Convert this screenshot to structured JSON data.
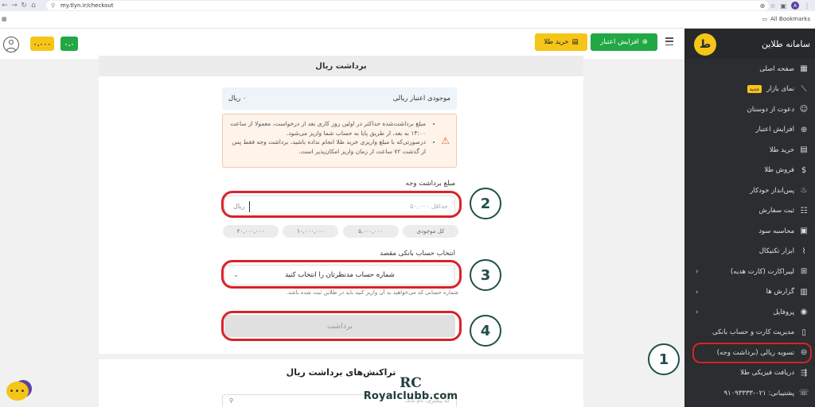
{
  "browser": {
    "url": "my.tlyn.ir/checkout",
    "profile_initial": "A",
    "all_bookmarks": "All Bookmarks"
  },
  "header": {
    "balance_yellow": "۰.۰۰۰",
    "balance_green": "۰.۰",
    "buy_gold_label": "خرید طلا",
    "increase_credit_label": "افزایش اعتبار"
  },
  "sidebar": {
    "title": "سامانه طلاین",
    "logo_letter": "ط",
    "items": [
      {
        "label": "صفحه اصلی",
        "icon": "grid-icon",
        "glyph": "▦"
      },
      {
        "label": "نمای بازار",
        "icon": "chart-icon",
        "glyph": "⟋",
        "badge": "جدید"
      },
      {
        "label": "دعوت از دوستان",
        "icon": "users-icon",
        "glyph": "☺"
      },
      {
        "label": "افزایش اعتبار",
        "icon": "plus-circle-icon",
        "glyph": "⊕"
      },
      {
        "label": "خرید طلا",
        "icon": "gold-bars-icon",
        "glyph": "▤"
      },
      {
        "label": "فروش طلا",
        "icon": "money-bag-icon",
        "glyph": "$"
      },
      {
        "label": "پس‌انداز خودکار",
        "icon": "piggy-bank-icon",
        "glyph": "♨"
      },
      {
        "label": "ثبت سفارش",
        "icon": "order-icon",
        "glyph": "☷"
      },
      {
        "label": "محاسبه سود",
        "icon": "calculator-icon",
        "glyph": "▣"
      },
      {
        "label": "ابزار تکنیکال",
        "icon": "technical-chart-icon",
        "glyph": "⌇"
      },
      {
        "label": "لیبراکارت (کارت هدیه)",
        "icon": "gift-icon",
        "glyph": "⊞",
        "chevron": true
      },
      {
        "label": "گزارش ها",
        "icon": "report-icon",
        "glyph": "▥",
        "chevron": true
      },
      {
        "label": "پروفایل",
        "icon": "profile-icon",
        "glyph": "◉",
        "chevron": true
      },
      {
        "label": "مدیریت کارت و حساب بانکی",
        "icon": "card-icon",
        "glyph": "▯"
      },
      {
        "label": "تسویه ریالی (برداشت وجه)",
        "icon": "dollar-circle-icon",
        "glyph": "⊜",
        "active": true
      },
      {
        "label": "دریافت فیزیکی طلا",
        "icon": "truck-icon",
        "glyph": "⇶"
      },
      {
        "label": "پشتیبانی: ۰۲۱-۹۱۰۹۳۳۳۳",
        "icon": "headset-icon",
        "glyph": "☏"
      }
    ]
  },
  "withdraw": {
    "title": "برداشت ریال",
    "balance_label": "موجودی اعتبار ریالی",
    "balance_value": "۰ ریال",
    "notes": [
      "مبلغ برداشت‌شده حداکثر در اولین روز کاری بعد از درخواست، معمولا از ساعت ۱۴:۰۰ به بعد، از طریق پایا به حساب شما واریز می‌شود.",
      "درصورتی‌که با مبلغ واریزی خرید طلا انجام نداده باشید، برداشت وجه فقط پس از گذشت ۷۲ ساعت از زمان واریز امکان‌پذیر است."
    ],
    "amount_label": "مبلغ برداشت وجه",
    "amount_placeholder": "حداقل ۵۰,۰۰۰",
    "amount_unit": "ریال",
    "quick_amounts": [
      "کل موجودی",
      "۵,۰۰۰,۰۰۰",
      "۱۰,۰۰۰,۰۰۰",
      "۲۰,۰۰۰,۰۰۰"
    ],
    "bank_label": "انتخاب حساب بانکی مقصد",
    "bank_placeholder": "شماره حساب مدنظرتان را انتخاب کنید",
    "bank_helper": "شماره حسابی که می‌خواهید به آن واریز کنید باید در طلاین ثبت شده باشد.",
    "submit_label": "برداشت"
  },
  "transactions": {
    "title": "تراکنش‌های برداشت ریال",
    "search_placeholder": "کد پیگیری، نام بانک"
  },
  "annotations": {
    "step1": "1",
    "step2": "2",
    "step3": "3",
    "step4": "4",
    "ring_color": "#d8232a"
  },
  "watermark": {
    "logo": "RC",
    "text": "Royalclubb.com"
  },
  "chat": {
    "glyph": "•••"
  },
  "colors": {
    "brand_yellow": "#f5c518",
    "brand_green": "#21a744",
    "sidebar_bg": "#2b2d31"
  }
}
